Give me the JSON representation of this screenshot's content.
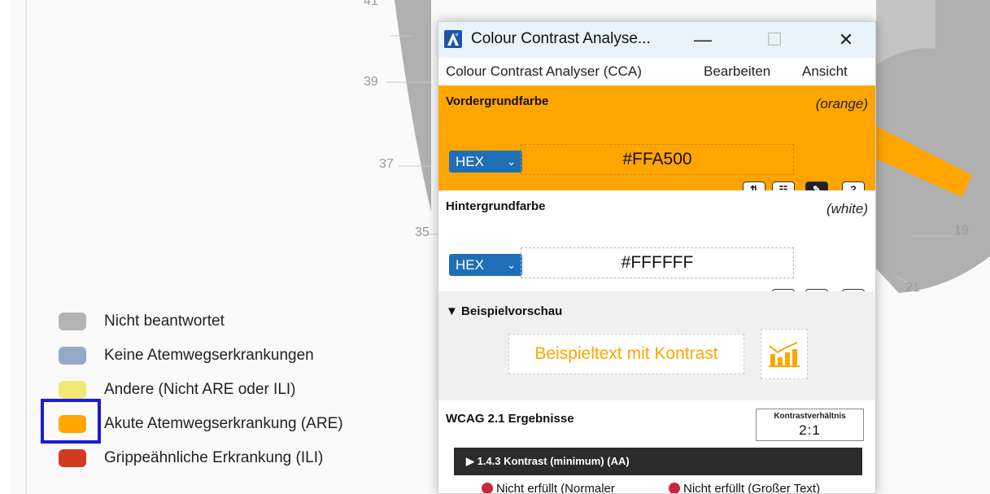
{
  "background": {
    "axis_labels": [
      "41",
      "39",
      "37",
      "35",
      "19",
      "21"
    ],
    "legend": [
      {
        "label": "Nicht beantwortet",
        "color": "#b5b5b5"
      },
      {
        "label": "Keine Atemwegserkrankungen",
        "color": "#98a9c8"
      },
      {
        "label": "Andere (Nicht ARE oder ILI)",
        "color": "#f3e873"
      },
      {
        "label": "Akute Atemwegserkrankung (ARE)",
        "color": "#ffa500"
      },
      {
        "label": "Grippeähnliche Erkrankung (ILI)",
        "color": "#d33a24"
      }
    ],
    "focus_color": "#1a1adb"
  },
  "window": {
    "title": "Colour Contrast Analyse...",
    "minimize": "—",
    "maximize": "☐",
    "close": "✕"
  },
  "menu": [
    "Colour Contrast Analyser (CCA)",
    "Bearbeiten",
    "Ansicht"
  ],
  "foreground": {
    "title": "Vordergrundfarbe",
    "name": "(orange)",
    "format": "HEX",
    "value": "#FFA500",
    "tools": [
      "⇅",
      "☷",
      "✎",
      "?"
    ]
  },
  "background_color": {
    "title": "Hintergrundfarbe",
    "name": "(white)",
    "format": "HEX",
    "value": "#FFFFFF",
    "tools": [
      "☷",
      "✎",
      "?"
    ]
  },
  "preview": {
    "title": "▼ Beispielvorschau",
    "sample_text": "Beispieltext mit Kontrast"
  },
  "wcag": {
    "title": "WCAG 2.1 Ergebnisse",
    "ratio_label": "Kontrastverhältnis",
    "ratio_value": "2:1",
    "criterion": "▶  1.4.3 Kontrast (minimum) (AA)",
    "result_normal": "Nicht erfüllt (Normaler",
    "result_large": "Nicht erfüllt (Großer Text)"
  }
}
